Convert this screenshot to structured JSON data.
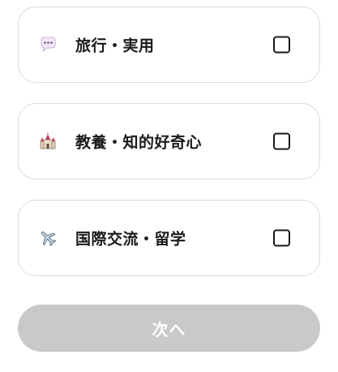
{
  "options": [
    {
      "label": "旅行・実用",
      "icon": "speech-bubble-icon",
      "checked": false
    },
    {
      "label": "教養・知的好奇心",
      "icon": "castle-icon",
      "checked": false
    },
    {
      "label": "国際交流・留学",
      "icon": "airplane-icon",
      "checked": false
    }
  ],
  "next_button": {
    "label": "次へ",
    "enabled": false
  },
  "colors": {
    "card_border": "#dcdcdc",
    "button_disabled": "#c9c9c9",
    "text": "#1a1a1a"
  }
}
